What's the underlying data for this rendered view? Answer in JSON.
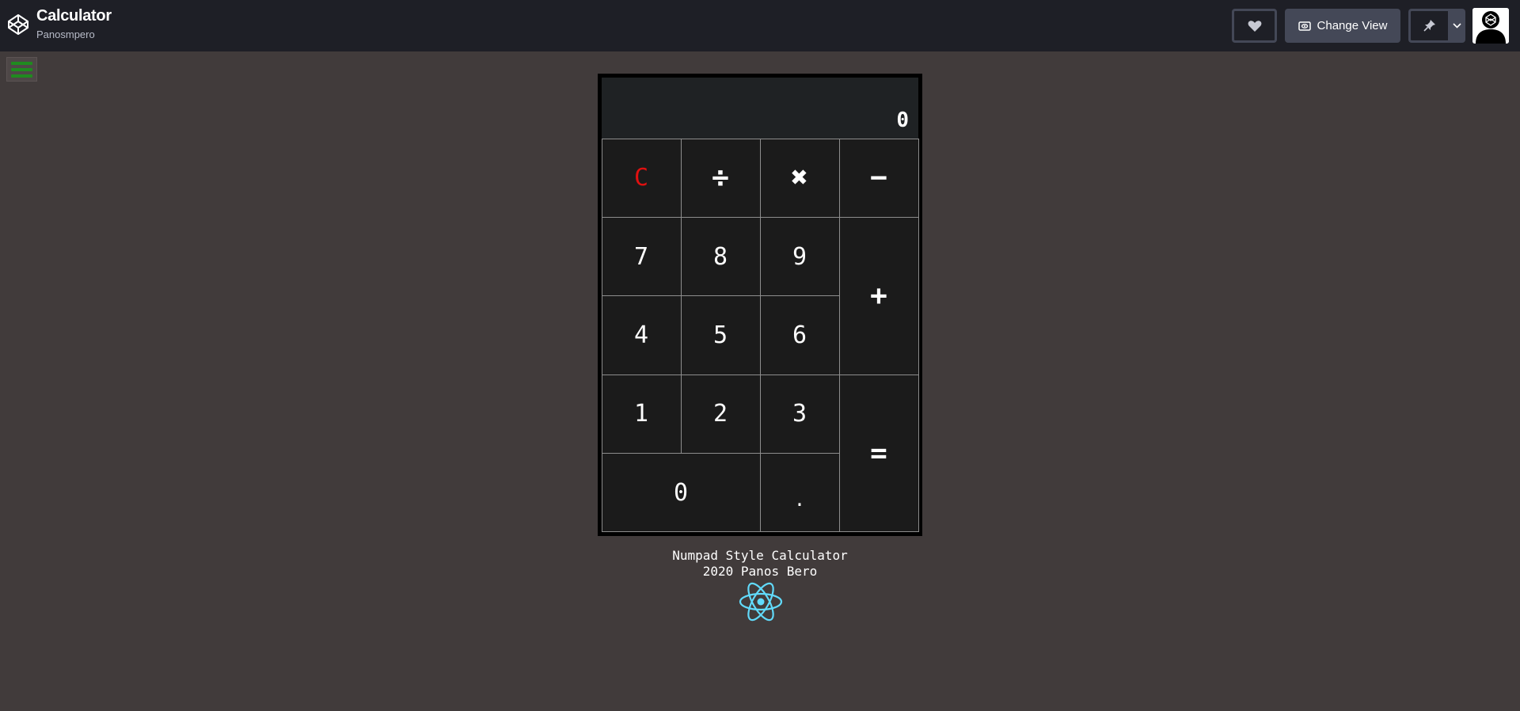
{
  "header": {
    "title": "Calculator",
    "author": "Panosmpero",
    "change_view_label": "Change View",
    "icons": {
      "logo": "codepen-logo-icon",
      "like": "heart-icon",
      "view": "eye-icon",
      "pin": "pin-icon",
      "dropdown": "chevron-down-icon"
    }
  },
  "menu": {
    "icon": "hamburger-menu-icon",
    "color": "#1f8a1f"
  },
  "calculator": {
    "display": "0",
    "keys": {
      "clear": "C",
      "divide": "÷",
      "multiply": "✖",
      "subtract": "−",
      "add": "+",
      "equals": "=",
      "seven": "7",
      "eight": "8",
      "nine": "9",
      "four": "4",
      "five": "5",
      "six": "6",
      "one": "1",
      "two": "2",
      "three": "3",
      "zero": "0",
      "decimal": "."
    },
    "colors": {
      "clear_key": "#e01010",
      "display_bg": "#1f2224",
      "key_bg": "#1b1b1b"
    }
  },
  "footer": {
    "line1": "Numpad Style Calculator",
    "line2": "2020 Panos Bero",
    "icon": "react-logo-icon",
    "icon_color": "#61dafb"
  }
}
